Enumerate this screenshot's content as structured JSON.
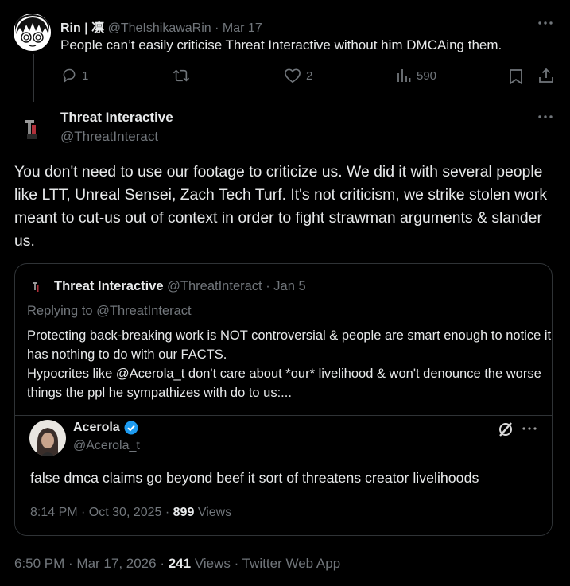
{
  "reply": {
    "name": "Rin | 凛",
    "handle": "@TheIshikawaRin",
    "date": "Mar 17",
    "sep": "·",
    "text": "People can’t easily criticise Threat Interactive without him DMCAing them.",
    "replies": "1",
    "likes": "2",
    "views": "590"
  },
  "main": {
    "name": "Threat Interactive",
    "handle": "@ThreatInteract",
    "text": "You don't need to use our footage to criticize us. We did it with several people like LTT, Unreal Sensei, Zach Tech Turf. It's not criticism, we strike stolen work meant to cut-us out of context in order to fight strawman arguments & slander us.",
    "footer_time": "6:50 PM · Mar 17, 2026 ·",
    "footer_views_count": "241",
    "footer_views_label": "Views",
    "footer_source": "· Twitter Web App"
  },
  "quote": {
    "name": "Threat Interactive",
    "handle": "@ThreatInteract",
    "date": "· Jan 5",
    "replying_to": "Replying to @ThreatInteract",
    "text": "Protecting back-breaking work is NOT controversial & people are smart enough to notice it has nothing to do with our FACTS.\nHypocrites like @Acerola_t don't care about *our* livelihood & won't denounce the worse things the ppl he sympathizes with do to us:...",
    "embed": {
      "name": "Acerola",
      "handle": "@Acerola_t",
      "text": "false dmca claims go beyond beef it sort of threatens creator livelihoods",
      "time": "8:14 PM · Oct 30, 2025 ·",
      "views_count": "899",
      "views_label": "Views"
    }
  },
  "icons": {
    "reply": "reply-icon",
    "retweet": "retweet-icon",
    "like": "heart-icon",
    "views": "views-icon",
    "bookmark": "bookmark-icon",
    "share": "share-icon",
    "more": "more-icon",
    "verified": "verified-badge-icon",
    "grok": "grok-icon"
  },
  "colors": {
    "background": "#000000",
    "text": "#e7e9ea",
    "muted": "#71767b",
    "verified": "#1d9bf0",
    "border": "#2f3336"
  }
}
